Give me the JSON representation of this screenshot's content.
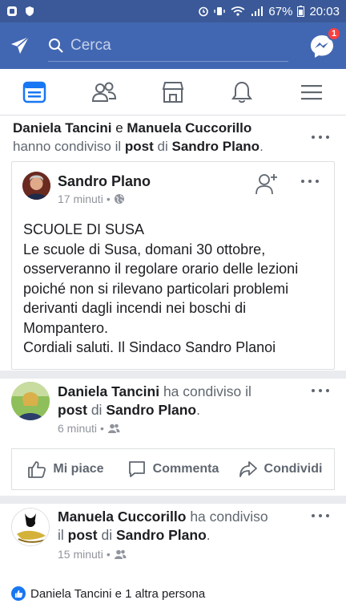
{
  "status_bar": {
    "battery": "67%",
    "time": "20:03"
  },
  "header": {
    "search_placeholder": "Cerca",
    "messenger_badge": "1"
  },
  "tabs": [
    {
      "name": "news-feed",
      "icon": "news-feed-icon",
      "active": true
    },
    {
      "name": "friends",
      "icon": "friends-icon"
    },
    {
      "name": "marketplace",
      "icon": "marketplace-icon"
    },
    {
      "name": "notifications",
      "icon": "bell-icon"
    },
    {
      "name": "menu",
      "icon": "menu-icon"
    }
  ],
  "story1": {
    "actor1": "Daniela Tancini",
    "conj": "e",
    "actor2": "Manuela Cuccorillo",
    "verb": "hanno condiviso il",
    "object": "post",
    "of": "di",
    "author": "Sandro Plano",
    "end": "."
  },
  "shared_post": {
    "author": "Sandro Plano",
    "time": "17 minuti",
    "lines": [
      "SCUOLE DI SUSA",
      "Le scuole di Susa, domani 30 ottobre,",
      "osserveranno il regolare orario delle lezioni",
      "poiché non si rilevano particolari problemi",
      "derivanti dagli incendi nei boschi di",
      "Mompantero.",
      "Cordiali saluti. Il Sindaco Sandro Planoi"
    ]
  },
  "story2": {
    "actor": "Daniela Tancini",
    "verb": "ha condiviso il",
    "object": "post",
    "of": "di",
    "author": "Sandro Plano",
    "end": ".",
    "time": "6 minuti"
  },
  "actions": {
    "like": "Mi piace",
    "comment": "Commenta",
    "share": "Condividi"
  },
  "story3": {
    "actor": "Manuela Cuccorillo",
    "verb": "ha condiviso",
    "pre_object": "il",
    "object": "post",
    "of": "di",
    "author": "Sandro Plano",
    "end": ".",
    "time": "15 minuti"
  },
  "likes_summary": "Daniela Tancini e 1 altra persona",
  "colors": {
    "brand": "#4267b2",
    "status_bar": "#3b5998",
    "badge": "#fa3e3e",
    "like_blue": "#1877f2"
  }
}
